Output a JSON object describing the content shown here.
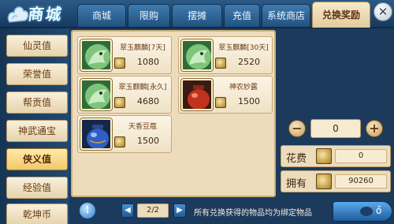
{
  "header": {
    "logo_text": "商城",
    "tabs": [
      {
        "label": "商城"
      },
      {
        "label": "限购"
      },
      {
        "label": "摆摊"
      },
      {
        "label": "充值"
      },
      {
        "label": "系统商店"
      },
      {
        "label": "兑换奖励"
      }
    ],
    "active_tab": "兑换奖励",
    "close_glyph": "✕"
  },
  "sidebar": {
    "items": [
      {
        "label": "仙灵值"
      },
      {
        "label": "荣誉值"
      },
      {
        "label": "帮贡值"
      },
      {
        "label": "神武通宝"
      },
      {
        "label": "侠义值"
      },
      {
        "label": "经验值"
      },
      {
        "label": "乾坤币"
      }
    ],
    "active_item": "侠义值"
  },
  "items": [
    {
      "name": "翠玉麒麟[7天]",
      "price": "1080",
      "icon": "jade-qilin-icon"
    },
    {
      "name": "翠玉麒麟[30天]",
      "price": "2520",
      "icon": "jade-qilin-icon"
    },
    {
      "name": "翠玉麒麟[永久]",
      "price": "4680",
      "icon": "jade-qilin-icon"
    },
    {
      "name": "神农妙露",
      "price": "1500",
      "icon": "red-jar-icon"
    },
    {
      "name": "天香豆蔻",
      "price": "1500",
      "icon": "blue-jar-icon"
    }
  ],
  "purchase": {
    "quantity": "0",
    "minus_glyph": "−",
    "plus_glyph": "+",
    "cost_label": "花费",
    "cost_value": "0",
    "owned_label": "拥有",
    "owned_value": "90260"
  },
  "pagination": {
    "page": "2/2",
    "prev_glyph": "◀",
    "next_glyph": "▶"
  },
  "notice": "所有兑换获得的物品均为绑定物品",
  "info_glyph": "!",
  "exchange_button_label": "ő"
}
